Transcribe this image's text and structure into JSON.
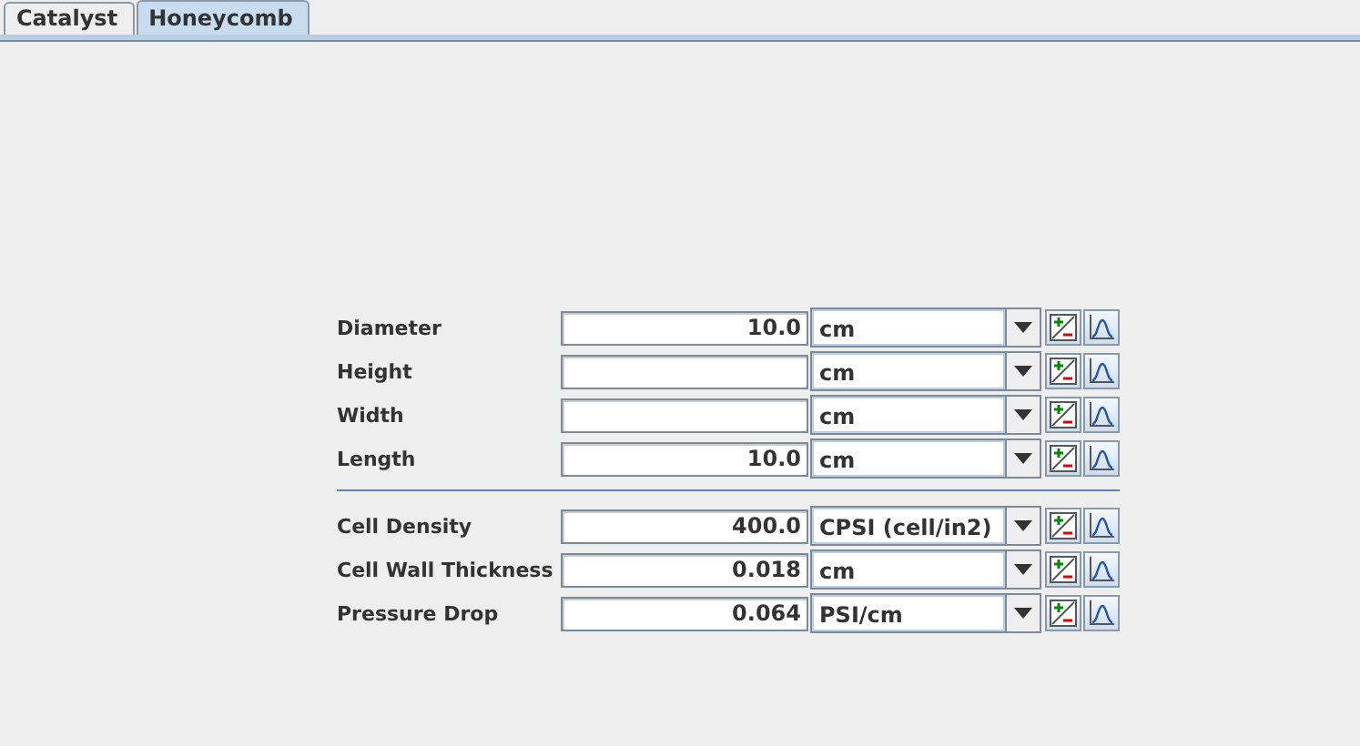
{
  "tabs": [
    {
      "label": "Catalyst",
      "selected": false
    },
    {
      "label": "Honeycomb",
      "selected": true
    }
  ],
  "groups": [
    {
      "rows": [
        {
          "label": "Diameter",
          "value": "10.0",
          "unit": "cm"
        },
        {
          "label": "Height",
          "unit": "cm"
        },
        {
          "label": "Width",
          "unit": "cm"
        },
        {
          "label": "Length",
          "value": "10.0",
          "unit": "cm"
        }
      ]
    },
    {
      "rows": [
        {
          "label": "Cell Density",
          "value": "400.0",
          "unit": "CPSI (cell/in2)"
        },
        {
          "label": "Cell Wall Thickness",
          "value": "0.018",
          "unit": "cm"
        },
        {
          "label": "Pressure Drop",
          "value": "0.064",
          "unit": "PSI/cm"
        }
      ]
    }
  ]
}
